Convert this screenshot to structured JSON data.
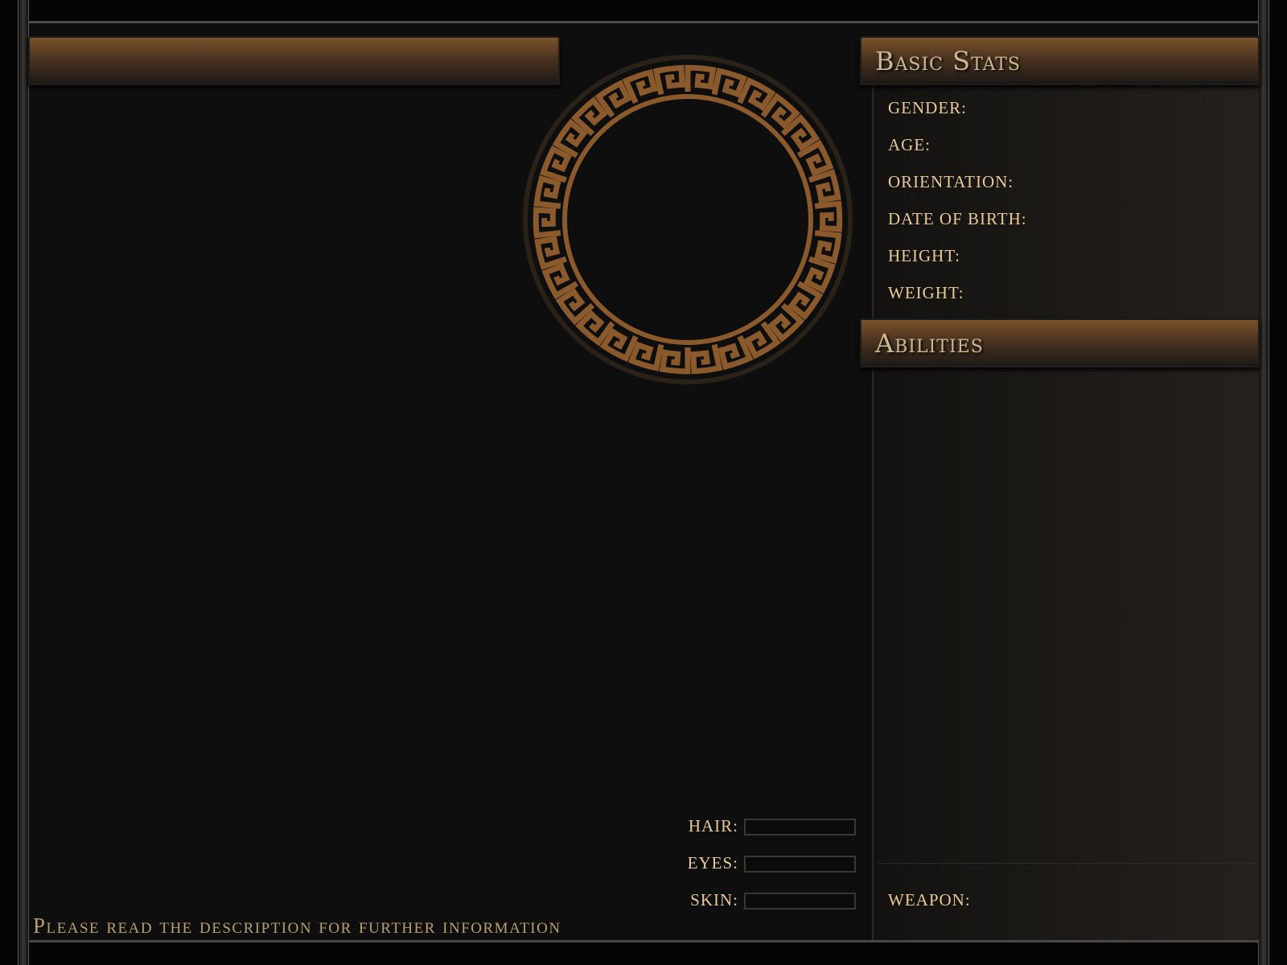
{
  "colors": {
    "accent": "#7a522a",
    "label": "#e9c999",
    "ornament": "#8a5a2c"
  },
  "left_header": {
    "title": ""
  },
  "portrait": {
    "icon": "greek-key-ring"
  },
  "basic_stats": {
    "title": "Basic Stats",
    "fields": [
      {
        "label": "GENDER:"
      },
      {
        "label": "AGE:"
      },
      {
        "label": "ORIENTATION:"
      },
      {
        "label": "DATE OF BIRTH:"
      },
      {
        "label": "HEIGHT:"
      },
      {
        "label": "WEIGHT:"
      }
    ]
  },
  "abilities": {
    "title": "Abilities"
  },
  "weapon": {
    "label": "WEAPON:"
  },
  "features": [
    {
      "label": "HAIR:",
      "value": ""
    },
    {
      "label": "EYES:",
      "value": ""
    },
    {
      "label": "SKIN:",
      "value": ""
    }
  ],
  "footer": {
    "text": "Please read the description for further information"
  }
}
